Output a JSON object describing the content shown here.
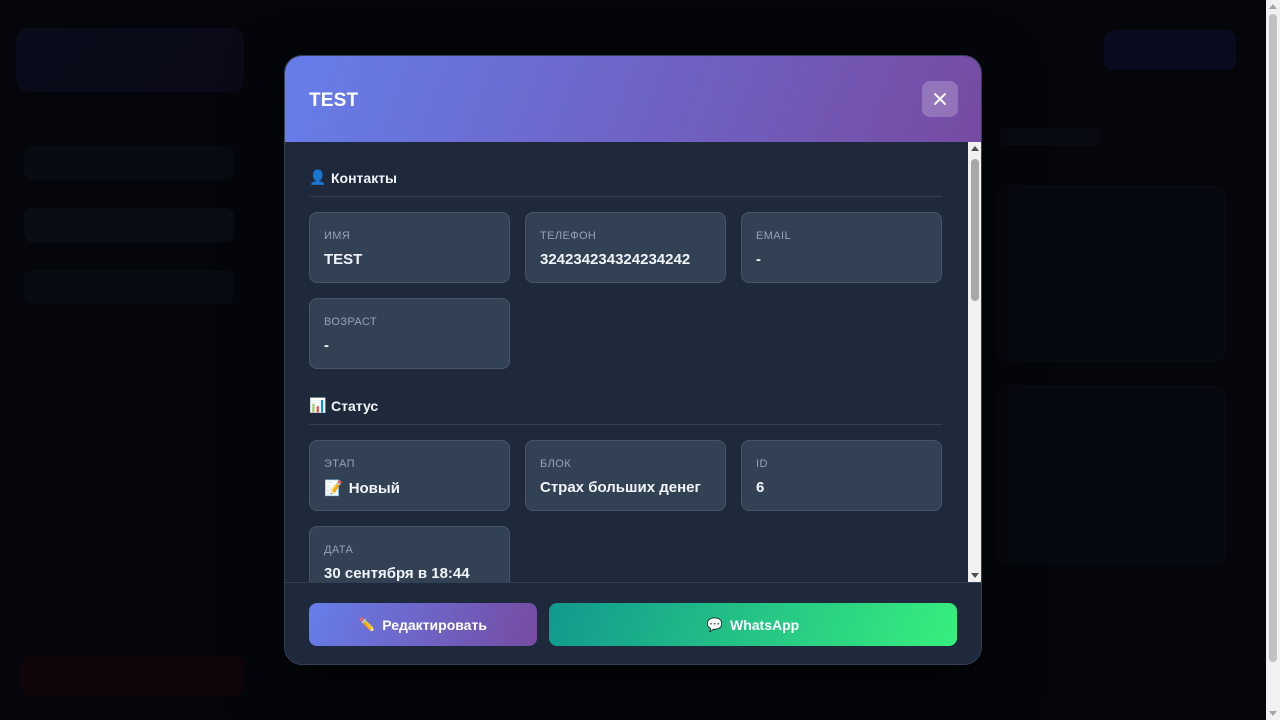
{
  "modal": {
    "title": "TEST",
    "sections": {
      "contacts": {
        "icon": "👤",
        "title": "Контакты",
        "fields": {
          "name": {
            "label": "Имя",
            "value": "TEST"
          },
          "phone": {
            "label": "Телефон",
            "value": "324234234324234242"
          },
          "email": {
            "label": "Email",
            "value": "-"
          },
          "age": {
            "label": "Возраст",
            "value": "-"
          }
        }
      },
      "status": {
        "icon": "📊",
        "title": "Статус",
        "fields": {
          "stage": {
            "label": "Этап",
            "icon": "📝",
            "value": "Новый"
          },
          "block": {
            "label": "Блок",
            "value": "Страх больших денег"
          },
          "id": {
            "label": "ID",
            "value": "6"
          },
          "date": {
            "label": "Дата",
            "value": "30 сентября в 18:44"
          }
        }
      }
    },
    "buttons": {
      "edit": {
        "icon": "✏️",
        "label": "Редактировать"
      },
      "whatsapp": {
        "icon": "💬",
        "label": "WhatsApp"
      }
    }
  },
  "colors": {
    "header_gradient_start": "#667eea",
    "header_gradient_end": "#764ba2",
    "whatsapp_gradient_start": "#11998e",
    "whatsapp_gradient_end": "#38ef7d",
    "modal_bg": "#1e293b",
    "field_bg": "#334155"
  }
}
